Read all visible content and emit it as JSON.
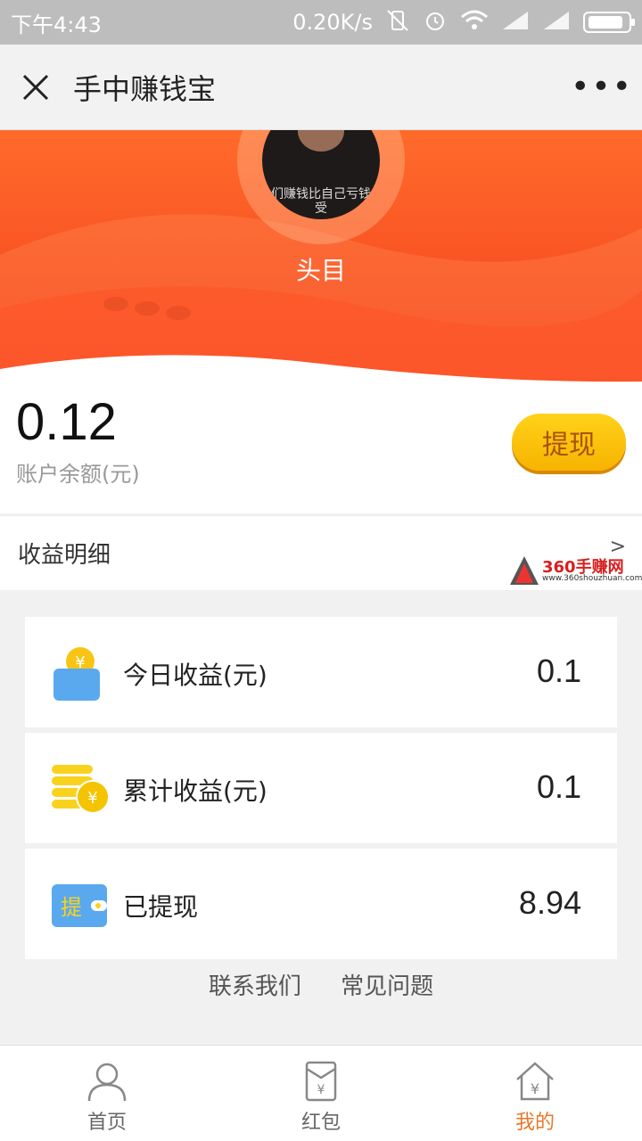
{
  "status_bar": {
    "time": "下午4:43",
    "network_speed": "0.20K/s",
    "icons": [
      "vibrate-off-icon",
      "alarm-icon",
      "wifi-icon",
      "signal-icon",
      "signal-icon",
      "battery-icon"
    ]
  },
  "title_bar": {
    "title": "手中赚钱宝",
    "close_icon": "close-icon",
    "more_icon": "more-icon",
    "more_glyph": "•••"
  },
  "profile": {
    "avatar_caption": "们赚钱比自己亏钱受",
    "username": "头目"
  },
  "balance": {
    "value": "0.12",
    "label": "账户余额(元)",
    "withdraw_label": "提现"
  },
  "detail": {
    "label": "收益明细",
    "arrow": ">"
  },
  "watermark": {
    "text": "360手赚网",
    "url": "www.360shouzhuan.com"
  },
  "stats": [
    {
      "label": "今日收益(元)",
      "value": "0.1",
      "icon": "wallet-coin-icon"
    },
    {
      "label": "累计收益(元)",
      "value": "0.1",
      "icon": "coin-stack-icon"
    },
    {
      "label": "已提现",
      "value": "8.94",
      "icon": "withdraw-card-icon",
      "icon_text": "提"
    }
  ],
  "links": {
    "contact": "联系我们",
    "faq": "常见问题"
  },
  "tabs": [
    {
      "label": "首页",
      "icon": "person-icon",
      "active": false
    },
    {
      "label": "红包",
      "icon": "red-envelope-icon",
      "active": false
    },
    {
      "label": "我的",
      "icon": "home-yen-icon",
      "active": true
    }
  ],
  "colors": {
    "accent": "#e8772a",
    "hero_orange": "#ff6a2a",
    "withdraw_yellow": "#fbc105"
  }
}
